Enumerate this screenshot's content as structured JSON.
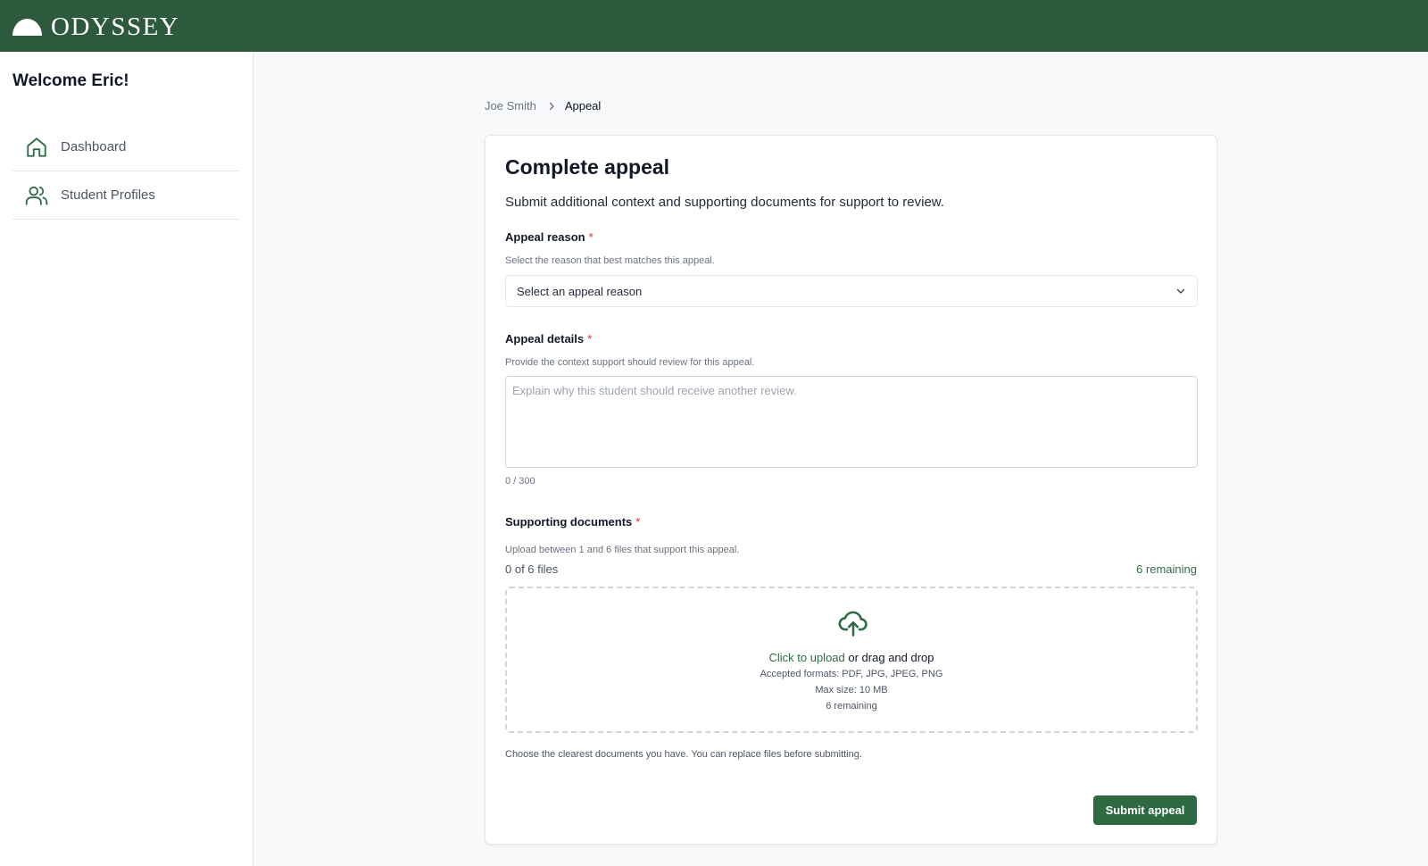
{
  "app": {
    "brand": "ODYSSEY",
    "colors": {
      "header_bg": "#2d5a3d",
      "accent": "#2f6b44",
      "button_bg": "#2d6a42",
      "required": "#dc2626"
    }
  },
  "sidebar": {
    "welcome": "Welcome Eric!",
    "items": [
      {
        "label": "Dashboard",
        "icon": "home-icon"
      },
      {
        "label": "Student Profiles",
        "icon": "users-icon"
      }
    ]
  },
  "breadcrumb": {
    "parent": "Joe Smith",
    "current": "Appeal"
  },
  "form": {
    "title": "Complete appeal",
    "subtitle": "Submit additional context and supporting documents for support to review.",
    "required_mark": "*",
    "reason": {
      "label": "Appeal reason",
      "help": "Select the reason that best matches this appeal.",
      "selected": "Select an appeal reason"
    },
    "details": {
      "label": "Appeal details",
      "help": "Provide the context support should review for this appeal.",
      "placeholder": "Explain why this student should receive another review.",
      "value": "",
      "char_count": "0 / 300"
    },
    "documents": {
      "label": "Supporting documents",
      "help": "Upload between 1 and 6 files that support this appeal.",
      "file_count": "0 of 6 files",
      "remaining": "6 remaining",
      "upload_link": "Click to upload",
      "upload_rest": "or drag and drop",
      "formats": "Accepted formats: PDF, JPG, JPEG, PNG",
      "max_size": "Max size: 10 MB",
      "dropzone_remaining": "6 remaining",
      "hint": "Choose the clearest documents you have. You can replace files before submitting."
    },
    "submit_label": "Submit appeal"
  }
}
